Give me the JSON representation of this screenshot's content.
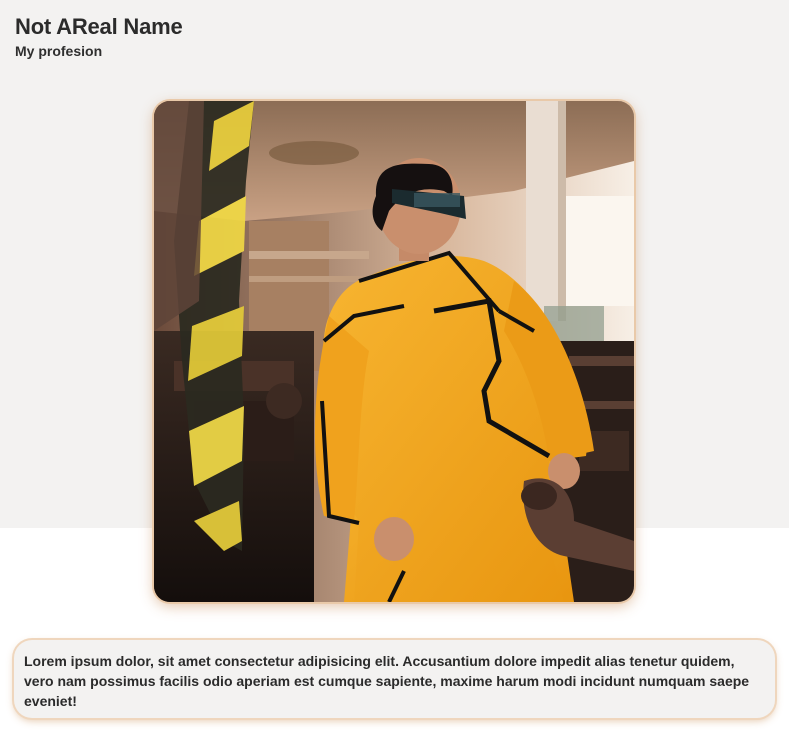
{
  "profile": {
    "name": "Not AReal Name",
    "profession": "My profesion"
  },
  "bio": {
    "text": "Lorem ipsum dolor, sit amet consectetur adipisicing elit. Accusantium dolore impedit alias tenetur quidem, vero nam possimus facilis odio aperiam est cumque sapiente, maxime harum modi incidunt numquam saepe eveniet!"
  },
  "colors": {
    "page_band": "#f3f2f1",
    "accent_glow": "#e9c9a9",
    "coat_yellow": "#f4a51c"
  }
}
